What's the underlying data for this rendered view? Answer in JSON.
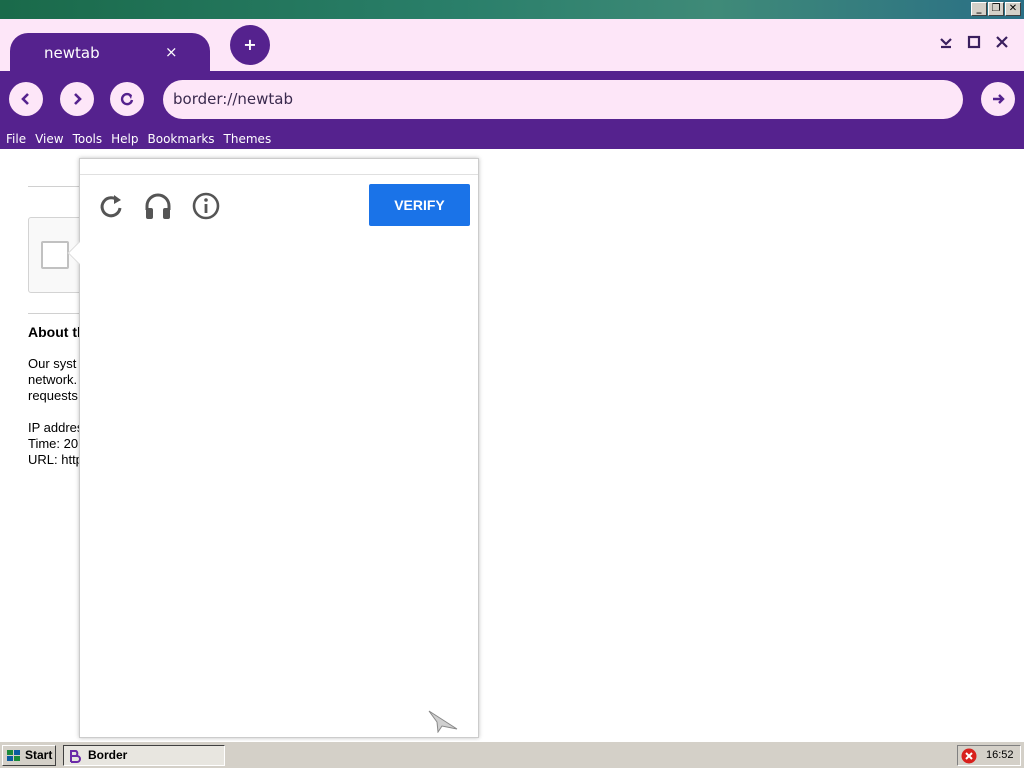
{
  "os_window": {
    "controls": [
      "_",
      "❐",
      "✕"
    ]
  },
  "browser": {
    "tab": {
      "title": "newtab",
      "close": "×"
    },
    "new_tab": "+",
    "window_controls": {
      "minimize": "⌄",
      "maximize": "□",
      "close": "✕"
    },
    "nav": {
      "back": "‹",
      "forward": "›",
      "reload": "↻",
      "go": "→"
    },
    "address": "border://newtab",
    "menu": [
      "File",
      "View",
      "Tools",
      "Help",
      "Bookmarks",
      "Themes"
    ]
  },
  "page": {
    "about_title": "About th",
    "lines": [
      "Our syst",
      "network.",
      "requests",
      "IP addres",
      "Time: 20",
      "URL: http"
    ]
  },
  "popup": {
    "verify_label": "VERIFY",
    "icons": [
      "reload-icon",
      "headphones-icon",
      "info-icon",
      "send-icon"
    ],
    "accent_color": "#1a73e8"
  },
  "taskbar": {
    "start_label": "Start",
    "task_label": "Border",
    "time": "16:52"
  }
}
